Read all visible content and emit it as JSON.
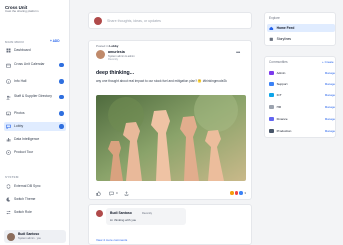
{
  "brand": {
    "title": "Cross Unit",
    "subtitle": "Cast the sharing platform"
  },
  "sidebar": {
    "section_main": "MAIN MENU",
    "add_label": "+ ADD",
    "items": [
      {
        "label": "Dashboard",
        "icon": "grid-icon",
        "badge": false,
        "active": false
      },
      {
        "label": "Cross Unit Calendar",
        "icon": "calendar-icon",
        "badge": true,
        "active": false
      },
      {
        "label": "Info Hall",
        "icon": "info-icon",
        "badge": true,
        "active": false
      },
      {
        "label": "Staff & Supplier Directory",
        "icon": "users-icon",
        "badge": true,
        "active": false
      },
      {
        "label": "Photos",
        "icon": "image-icon",
        "badge": true,
        "active": false
      },
      {
        "label": "Lobby",
        "icon": "chat-icon",
        "badge": true,
        "active": true
      },
      {
        "label": "Data Intelligence",
        "icon": "chart-icon",
        "badge": false,
        "active": false
      },
      {
        "label": "Product Tour",
        "icon": "compass-icon",
        "badge": false,
        "active": false
      }
    ],
    "section_system": "SYSTEM",
    "system_items": [
      {
        "label": "External DB Sync",
        "icon": "sync-icon"
      },
      {
        "label": "Switch Theme",
        "icon": "moon-icon"
      },
      {
        "label": "Switch Role",
        "icon": "switch-icon"
      }
    ],
    "user": {
      "name": "Budi Santoso",
      "role": "System admin · you"
    }
  },
  "composer": {
    "placeholder": "Share thoughts, ideas, or updates"
  },
  "post": {
    "posted_in_prefix": "Posted in",
    "posted_in_place": "Lobby",
    "author": "amurlesia",
    "author_role": "System admin & admin",
    "author_time": "Recently",
    "title": "deep thinking...",
    "body": "any one thought about real impact to our stock fuel and mitigation plan? 🤔 #thinkingmode2k",
    "comments_count": "0",
    "reactions_count": "3"
  },
  "comment": {
    "name": "Budi Santoso",
    "time": "Recently",
    "text": "im thinking with you",
    "view_more": "View 4 more comments"
  },
  "feeds_panel": {
    "heading": "Explore",
    "items": [
      {
        "label": "Home Feed",
        "active": true
      },
      {
        "label": "Storylines",
        "active": false
      }
    ]
  },
  "communities_panel": {
    "heading": "Communities",
    "create_label": "+ Create",
    "manage_label": "Manage",
    "items": [
      {
        "label": "Admin",
        "color": "#7c3aed"
      },
      {
        "label": "Support",
        "color": "#3b82f6"
      },
      {
        "label": "ICT",
        "color": "#0ea5e9"
      },
      {
        "label": "HR",
        "color": "#9ca3af"
      },
      {
        "label": "Finance",
        "color": "#6366f1"
      },
      {
        "label": "Production",
        "color": "#475569"
      }
    ]
  },
  "colors": {
    "accent": "#2563eb",
    "active_bg": "#e0ecff",
    "badge": "#2f6fdf"
  }
}
